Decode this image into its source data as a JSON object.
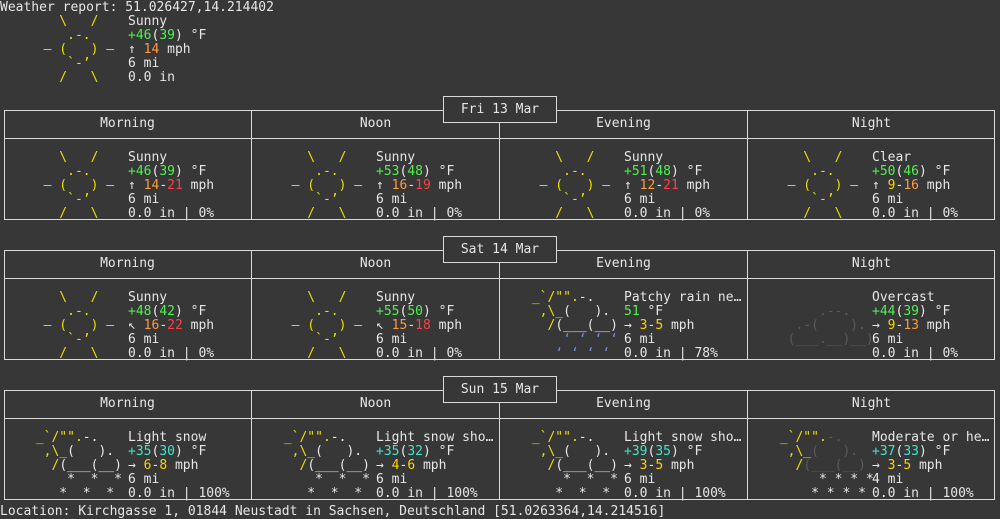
{
  "header": {
    "label": "Weather report: ",
    "coords": "51.026427,14.214402"
  },
  "current": {
    "condition": "Sunny",
    "icon": "sun",
    "temp": "+46",
    "feels": "39",
    "temp_unit": " °F",
    "wind_dir": "↑",
    "wind": "14",
    "wind_unit": " mph",
    "visibility": "6 mi",
    "precip": "0.0 in"
  },
  "days": [
    {
      "date": "Fri 13 Mar",
      "periods": [
        {
          "name": "Morning",
          "icon": "sun",
          "condition": "Sunny",
          "temp": "+46",
          "feels": "39",
          "temp_style": "green",
          "wind_dir": "↑",
          "wind_lo": "14",
          "wind_hi": "21",
          "wind_lo_style": "orange",
          "wind_hi_style": "red",
          "visibility": "6 mi",
          "precip": "0.0 in | 0%"
        },
        {
          "name": "Noon",
          "icon": "sun",
          "condition": "Sunny",
          "temp": "+53",
          "feels": "48",
          "temp_style": "green",
          "wind_dir": "↑",
          "wind_lo": "16",
          "wind_hi": "19",
          "wind_lo_style": "orange",
          "wind_hi_style": "red",
          "visibility": "6 mi",
          "precip": "0.0 in | 0%"
        },
        {
          "name": "Evening",
          "icon": "sun",
          "condition": "Sunny",
          "temp": "+51",
          "feels": "48",
          "temp_style": "green",
          "wind_dir": "↑",
          "wind_lo": "12",
          "wind_hi": "21",
          "wind_lo_style": "orange",
          "wind_hi_style": "red",
          "visibility": "6 mi",
          "precip": "0.0 in | 0%"
        },
        {
          "name": "Night",
          "icon": "sun",
          "condition": "Clear",
          "temp": "+50",
          "feels": "46",
          "temp_style": "green",
          "wind_dir": "↑",
          "wind_lo": "9",
          "wind_hi": "16",
          "wind_lo_style": "yellow",
          "wind_hi_style": "orange",
          "visibility": "6 mi",
          "precip": "0.0 in | 0%"
        }
      ]
    },
    {
      "date": "Sat 14 Mar",
      "periods": [
        {
          "name": "Morning",
          "icon": "sun",
          "condition": "Sunny",
          "temp": "+48",
          "feels": "42",
          "temp_style": "green",
          "wind_dir": "↖",
          "wind_lo": "16",
          "wind_hi": "22",
          "wind_lo_style": "orange",
          "wind_hi_style": "red",
          "visibility": "6 mi",
          "precip": "0.0 in | 0%"
        },
        {
          "name": "Noon",
          "icon": "sun",
          "condition": "Sunny",
          "temp": "+55",
          "feels": "50",
          "temp_style": "green",
          "wind_dir": "↖",
          "wind_lo": "15",
          "wind_hi": "18",
          "wind_lo_style": "orange",
          "wind_hi_style": "red",
          "visibility": "6 mi",
          "precip": "0.0 in | 0%"
        },
        {
          "name": "Evening",
          "icon": "rain",
          "condition": "Patchy rain nearby",
          "temp": "51",
          "feels": "",
          "temp_style": "green",
          "wind_dir": "→",
          "wind_lo": "3",
          "wind_hi": "5",
          "wind_lo_style": "yellow",
          "wind_hi_style": "yellow",
          "visibility": "6 mi",
          "precip": "0.0 in | 78%"
        },
        {
          "name": "Night",
          "icon": "cloud",
          "condition": "Overcast",
          "temp": "+44",
          "feels": "39",
          "temp_style": "green",
          "wind_dir": "→",
          "wind_lo": "9",
          "wind_hi": "13",
          "wind_lo_style": "yellow",
          "wind_hi_style": "orange",
          "visibility": "6 mi",
          "precip": "0.0 in | 0%"
        }
      ]
    },
    {
      "date": "Sun 15 Mar",
      "periods": [
        {
          "name": "Morning",
          "icon": "snow",
          "condition": "Light snow",
          "temp": "+35",
          "feels": "30",
          "temp_style": "cyan",
          "wind_dir": "→",
          "wind_lo": "6",
          "wind_hi": "8",
          "wind_lo_style": "yellow",
          "wind_hi_style": "yellow",
          "visibility": "6 mi",
          "precip": "0.0 in | 100%"
        },
        {
          "name": "Noon",
          "icon": "snow",
          "condition": "Light snow showers",
          "temp": "+35",
          "feels": "32",
          "temp_style": "cyan",
          "wind_dir": "→",
          "wind_lo": "4",
          "wind_hi": "6",
          "wind_lo_style": "yellow",
          "wind_hi_style": "yellow",
          "visibility": "6 mi",
          "precip": "0.0 in | 100%"
        },
        {
          "name": "Evening",
          "icon": "snow",
          "condition": "Light snow showers",
          "temp": "+39",
          "feels": "35",
          "temp_style": "cyan",
          "wind_dir": "→",
          "wind_lo": "3",
          "wind_hi": "5",
          "wind_lo_style": "yellow",
          "wind_hi_style": "yellow",
          "visibility": "6 mi",
          "precip": "0.0 in | 100%"
        },
        {
          "name": "Night",
          "icon": "snow_heavy",
          "condition": "Moderate or heavy snow",
          "temp": "+37",
          "feels": "33",
          "temp_style": "cyan",
          "wind_dir": "→",
          "wind_lo": "3",
          "wind_hi": "5",
          "wind_lo_style": "yellow",
          "wind_hi_style": "yellow",
          "visibility": "4 mi",
          "precip": "0.0 in | 100%"
        }
      ]
    }
  ],
  "footer": {
    "label": "Location: ",
    "address": "Kirchgasse 1, 01844 Neustadt in Sachsen, Deutschland",
    "coords": "[51.0263364,14.214516]"
  },
  "colors": {
    "background": "#373737",
    "text": "#e6e6e6",
    "sun": "#e8e000",
    "temp_green": "#4ef24e",
    "temp_cyan": "#3fe6c8",
    "wind_yellow": "#ffd200",
    "wind_orange": "#ff9a3d",
    "wind_red": "#ff4040",
    "rain": "#6f8fd8",
    "cloud_gray": "#5a5a5a"
  }
}
